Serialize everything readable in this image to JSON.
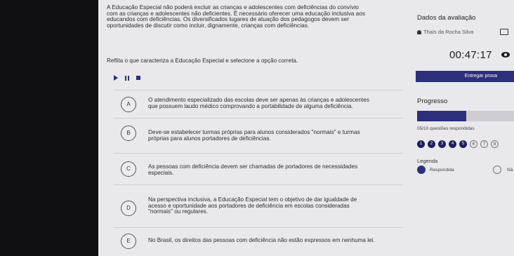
{
  "question": {
    "lines": [
      "A Educação Especial não poderá excluir as crianças e adolescentes com deficiências do convívio",
      "com as crianças e adolescentes não deficientes. É necessário oferecer uma educação inclusiva aos",
      "educandos com deficiências. Os diversificados lugares de atuação dos pedagogos devem ser",
      "oportunidades de discutir como incluir, dignamente, crianças com deficiências."
    ],
    "prompt": "Reflita o que caracteriza a Educação Especial e selecione a opção correta."
  },
  "options": [
    {
      "letter": "A",
      "lines": [
        "O atendimento especializado das escolas deve ser apenas às crianças e adolescentes",
        "que possuem laudo médico comprovando a portabilidade de alguma deficiência."
      ]
    },
    {
      "letter": "B",
      "lines": [
        "Deve-se estabelecer turmas próprias para alunos considerados \"normais\" e turmas",
        "próprias para alunos portadores de deficiências."
      ]
    },
    {
      "letter": "C",
      "lines": [
        "As pessoas com deficiência devem ser chamadas de portadores de necessidades",
        "especiais."
      ]
    },
    {
      "letter": "D",
      "lines": [
        "Na perspectiva inclusiva, a Educação Especial tem o objetivo de dar igualdade de",
        "acesso e oportunidade aos portadores de deficiência em escolas consideradas",
        "\"normais\" ou regulares."
      ]
    },
    {
      "letter": "E",
      "lines": [
        "No Brasil, os direitos das pessoas com deficiência não estão expressos em nenhuma lei."
      ]
    }
  ],
  "sidebar": {
    "title": "Dados da avaliação",
    "user": "Thaís da Rocha Silva",
    "timer": "00:47:17",
    "submit_label": "Entregar prova",
    "progress_title": "Progresso",
    "progress_fraction": 0.5,
    "answered_text": "05/10 questões respondidas",
    "question_numbers": [
      {
        "n": "1",
        "answered": true
      },
      {
        "n": "2",
        "answered": true
      },
      {
        "n": "3",
        "answered": true
      },
      {
        "n": "4",
        "answered": true
      },
      {
        "n": "5",
        "answered": true
      },
      {
        "n": "6",
        "answered": false
      },
      {
        "n": "7",
        "answered": false
      },
      {
        "n": "8",
        "answered": false
      }
    ],
    "legend_title": "Legenda",
    "legend_answered": "Respondida",
    "legend_unanswered": "Nã"
  },
  "colors": {
    "accent": "#2e2f7a",
    "background": "#e9e8ec"
  }
}
